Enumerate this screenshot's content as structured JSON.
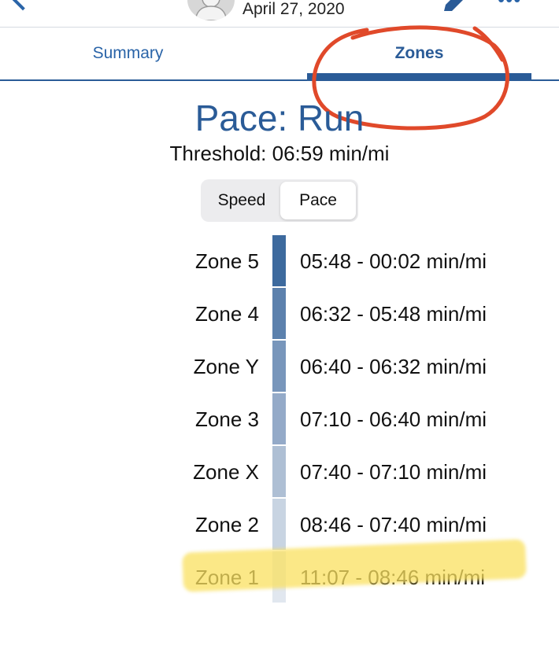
{
  "header": {
    "date": "April 27, 2020"
  },
  "tabs": [
    {
      "label": "Summary",
      "active": false
    },
    {
      "label": "Zones",
      "active": true
    }
  ],
  "page": {
    "title": "Pace: Run",
    "threshold": "Threshold: 06:59 min/mi"
  },
  "toggle": {
    "options": [
      "Speed",
      "Pace"
    ],
    "selected": "Pace"
  },
  "zones": [
    {
      "name": "Zone 5",
      "range": "05:48 - 00:02 min/mi",
      "color": "#3d6a9e"
    },
    {
      "name": "Zone 4",
      "range": "06:32 - 05:48 min/mi",
      "color": "#5c81ad"
    },
    {
      "name": "Zone Y",
      "range": "06:40 - 06:32 min/mi",
      "color": "#7896bb"
    },
    {
      "name": "Zone 3",
      "range": "07:10 - 06:40 min/mi",
      "color": "#94aac8"
    },
    {
      "name": "Zone X",
      "range": "07:40 - 07:10 min/mi",
      "color": "#aebfd4"
    },
    {
      "name": "Zone 2",
      "range": "08:46 - 07:40 min/mi",
      "color": "#c8d4e2"
    },
    {
      "name": "Zone 1",
      "range": "11:07 - 08:46 min/mi",
      "color": "#e1e7ef"
    }
  ],
  "colors": {
    "accent": "#2a5b97",
    "annotation_circle": "#e0492a",
    "highlight": "#f8df5e"
  },
  "icons": [
    "back-chevron-icon",
    "avatar-icon",
    "pencil-icon",
    "more-icon"
  ]
}
